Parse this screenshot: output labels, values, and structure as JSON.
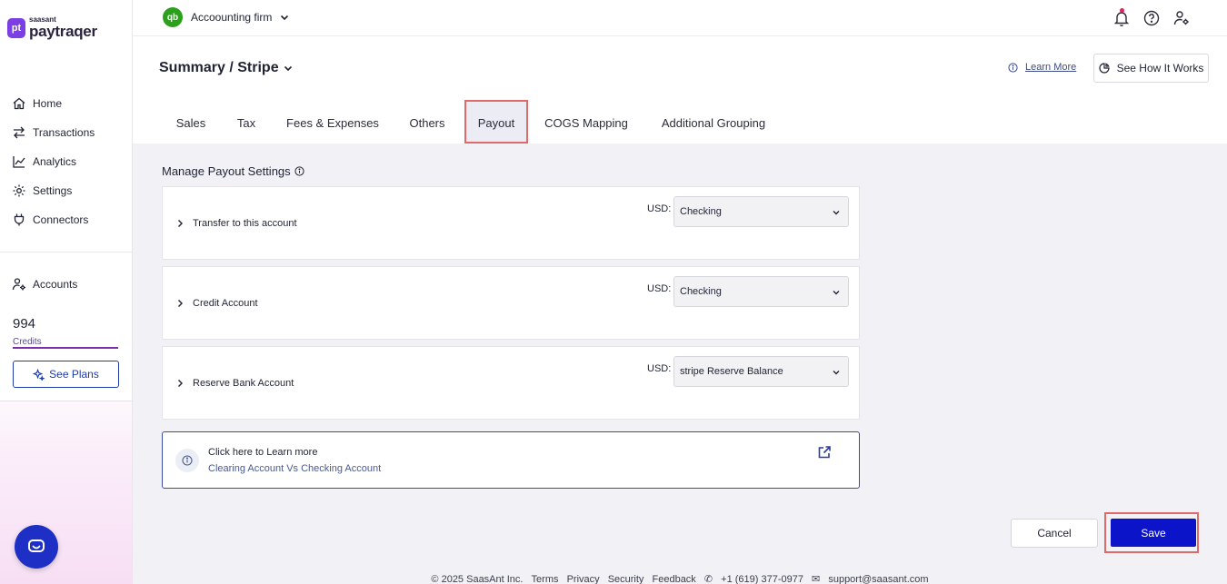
{
  "brand": {
    "small": "saasant",
    "name": "paytraqer",
    "mark": "pt"
  },
  "company": {
    "logo": "qb",
    "name": "Accoounting firm"
  },
  "sidebar": {
    "items": [
      {
        "icon": "home-icon",
        "label": "Home"
      },
      {
        "icon": "transfer-icon",
        "label": "Transactions"
      },
      {
        "icon": "analytics-icon",
        "label": "Analytics"
      },
      {
        "icon": "gear-icon",
        "label": "Settings"
      },
      {
        "icon": "plug-icon",
        "label": "Connectors"
      }
    ],
    "accounts_label": "Accounts",
    "credits": {
      "value": "994",
      "label": "Credits"
    },
    "see_plans_label": "See Plans"
  },
  "header": {
    "title": "Summary / Stripe",
    "learn_more": "Learn More",
    "how_it_works": "See How It Works"
  },
  "tabs": [
    {
      "label": "Sales",
      "active": false
    },
    {
      "label": "Tax",
      "active": false
    },
    {
      "label": "Fees & Expenses",
      "active": false
    },
    {
      "label": "Others",
      "active": false
    },
    {
      "label": "Payout",
      "active": true
    },
    {
      "label": "COGS Mapping",
      "active": false
    },
    {
      "label": "Additional Grouping",
      "active": false
    }
  ],
  "payout": {
    "section_title": "Manage Payout Settings",
    "rows": [
      {
        "label": "Transfer to this account",
        "currency": "USD:",
        "value": "Checking"
      },
      {
        "label": "Credit Account",
        "currency": "USD:",
        "value": "Checking"
      },
      {
        "label": "Reserve Bank Account",
        "currency": "USD:",
        "value": "stripe Reserve Balance"
      }
    ],
    "learn_card": {
      "title": "Click here to Learn more",
      "subtitle": "Clearing Account Vs Checking Account"
    }
  },
  "actions": {
    "cancel": "Cancel",
    "save": "Save"
  },
  "footer": {
    "copyright": "© 2025 SaasAnt Inc.",
    "links": [
      "Terms",
      "Privacy",
      "Security",
      "Feedback"
    ],
    "phone": "+1 (619) 377-0977",
    "email": "support@saasant.com"
  },
  "colors": {
    "accent": "#0b14c9",
    "brand": "#7b3fe4",
    "highlight": "#e06a6a",
    "qb_green": "#2ca01c"
  }
}
